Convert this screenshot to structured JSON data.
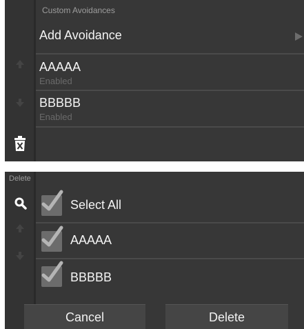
{
  "custom_avoidances": {
    "header": "Custom Avoidances",
    "add_label": "Add Avoidance",
    "items": [
      {
        "name": "AAAAA",
        "status": "Enabled"
      },
      {
        "name": "BBBBB",
        "status": "Enabled"
      }
    ],
    "icons": [
      "arrow-right-icon",
      "up-arrow-icon",
      "down-arrow-icon",
      "trash-icon"
    ]
  },
  "delete_screen": {
    "header": "Delete",
    "select_all_label": "Select All",
    "items": [
      "AAAAA",
      "BBBBB"
    ],
    "checked": [
      true,
      true,
      true
    ],
    "cancel_label": "Cancel",
    "delete_label": "Delete",
    "icons": [
      "search-icon",
      "check-icon",
      "up-arrow-icon",
      "down-arrow-icon"
    ]
  },
  "colors": {
    "background": "#373737",
    "text": "#f4f4f4",
    "muted_text": "#6a6a6a",
    "checkbox": "#6c6c6c",
    "button": "#454545"
  }
}
